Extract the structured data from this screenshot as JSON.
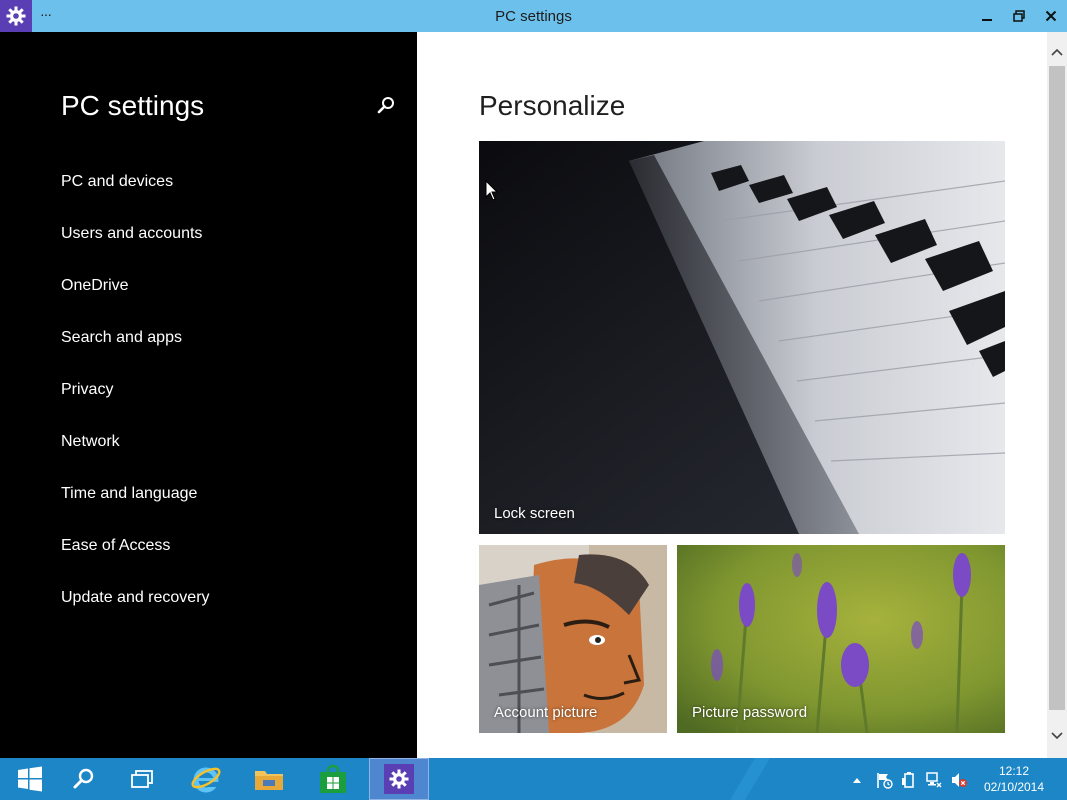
{
  "window": {
    "title": "PC settings",
    "menu_label": "···",
    "app_icon": "gear-icon",
    "controls": [
      "minimize-icon",
      "restore-icon",
      "close-icon"
    ]
  },
  "sidebar": {
    "title": "PC settings",
    "search_icon": "search-icon",
    "items": [
      {
        "label": "PC and devices"
      },
      {
        "label": "Users and accounts"
      },
      {
        "label": "OneDrive"
      },
      {
        "label": "Search and apps"
      },
      {
        "label": "Privacy"
      },
      {
        "label": "Network"
      },
      {
        "label": "Time and language"
      },
      {
        "label": "Ease of Access"
      },
      {
        "label": "Update and recovery"
      }
    ]
  },
  "main": {
    "title": "Personalize",
    "tiles": [
      {
        "label": "Lock screen"
      },
      {
        "label": "Account picture"
      },
      {
        "label": "Picture password"
      }
    ]
  },
  "taskbar": {
    "items": [
      "start-icon",
      "search-icon",
      "task-view-icon",
      "internet-explorer-icon",
      "file-explorer-icon",
      "store-icon",
      "settings-icon"
    ],
    "tray": [
      "show-hidden-icons-chevron",
      "action-center-flag-icon",
      "power-icon",
      "network-icon",
      "volume-muted-icon"
    ],
    "time": "12:12",
    "date": "02/10/2014"
  },
  "colors": {
    "titlebar": "#6cc0ec",
    "taskbar": "#1d86c6",
    "accent": "#5a3fb4"
  }
}
